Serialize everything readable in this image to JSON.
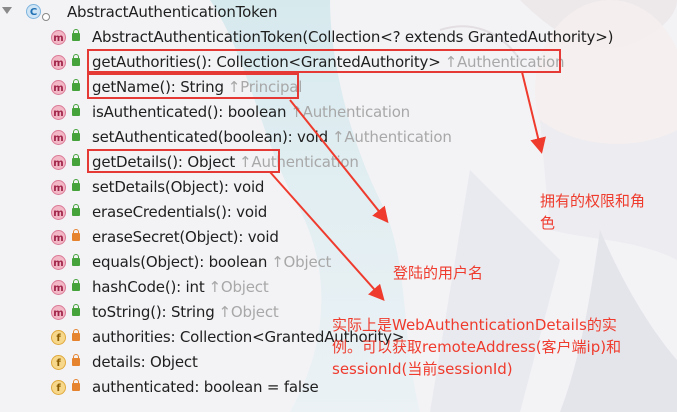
{
  "class_header": {
    "badge": "C",
    "name": "AbstractAuthenticationToken"
  },
  "members": [
    {
      "kind": "m",
      "lock": "green",
      "name": "AbstractAuthenticationToken(Collection<? extends GrantedAuthority>)",
      "inherited": ""
    },
    {
      "kind": "m",
      "lock": "green",
      "name": "getAuthorities(): Collection<GrantedAuthority>",
      "inherited": "↑Authentication"
    },
    {
      "kind": "m",
      "lock": "green",
      "name": "getName(): String",
      "inherited": "↑Principal"
    },
    {
      "kind": "m",
      "lock": "green",
      "name": "isAuthenticated(): boolean",
      "inherited": "↑Authentication"
    },
    {
      "kind": "m",
      "lock": "green",
      "name": "setAuthenticated(boolean): void",
      "inherited": "↑Authentication"
    },
    {
      "kind": "m",
      "lock": "green",
      "name": "getDetails(): Object",
      "inherited": "↑Authentication"
    },
    {
      "kind": "m",
      "lock": "green",
      "name": "setDetails(Object): void",
      "inherited": ""
    },
    {
      "kind": "m",
      "lock": "green",
      "name": "eraseCredentials(): void",
      "inherited": ""
    },
    {
      "kind": "m",
      "lock": "orange",
      "name": "eraseSecret(Object): void",
      "inherited": ""
    },
    {
      "kind": "m",
      "lock": "green",
      "name": "equals(Object): boolean",
      "inherited": "↑Object"
    },
    {
      "kind": "m",
      "lock": "green",
      "name": "hashCode(): int",
      "inherited": "↑Object"
    },
    {
      "kind": "m",
      "lock": "green",
      "name": "toString(): String",
      "inherited": "↑Object"
    },
    {
      "kind": "f",
      "lock": "orange",
      "name": "authorities: Collection<GrantedAuthority>",
      "inherited": ""
    },
    {
      "kind": "f",
      "lock": "orange",
      "name": "details: Object",
      "inherited": ""
    },
    {
      "kind": "f",
      "lock": "orange",
      "name": "authenticated: boolean = false",
      "inherited": ""
    }
  ],
  "annotations": {
    "authorities_note": [
      "拥有的权限和角",
      "色"
    ],
    "name_note": "登陆的用户名",
    "details_note": [
      "实际上是WebAuthenticationDetails的实",
      "例。可以获取remoteAddress(客户端ip)和",
      "sessionId(当前sessionId)"
    ]
  },
  "colors": {
    "annotation_red": "#ef3b2d",
    "method_badge": "#f2b8c6",
    "field_badge": "#f7d88a",
    "public_lock": "#46a23b",
    "private_lock": "#e5832f"
  }
}
